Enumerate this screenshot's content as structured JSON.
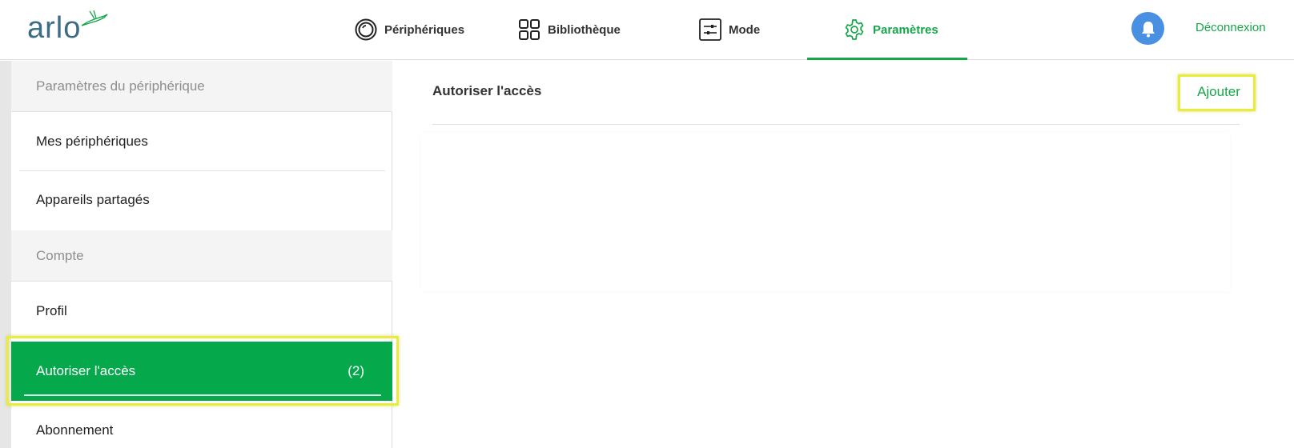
{
  "header": {
    "logo_text": "arlo",
    "nav": {
      "devices": "Périphériques",
      "library": "Bibliothèque",
      "mode": "Mode",
      "settings": "Paramètres"
    },
    "logout": "Déconnexion",
    "icons": {
      "devices": "camera-lens-icon",
      "library": "grid-icon",
      "mode": "sliders-icon",
      "settings": "gear-icon",
      "notifications": "bell-icon"
    }
  },
  "sidebar": {
    "sections": [
      {
        "title": "Paramètres du périphérique"
      },
      {
        "title": "Compte"
      }
    ],
    "items": [
      {
        "label": "Mes périphériques"
      },
      {
        "label": "Appareils partagés"
      },
      {
        "label": "Profil"
      },
      {
        "label": "Autoriser l'accès",
        "count": "(2)",
        "active": true
      },
      {
        "label": "Abonnement"
      }
    ]
  },
  "main": {
    "title": "Autoriser l'accès",
    "add_label": "Ajouter"
  },
  "colors": {
    "accent_green": "#15a64a",
    "active_bg": "#06a84c",
    "bell_blue": "#4a90e2",
    "highlight_yellow": "#e8ec3c",
    "logo_blue": "#3d6d86"
  }
}
